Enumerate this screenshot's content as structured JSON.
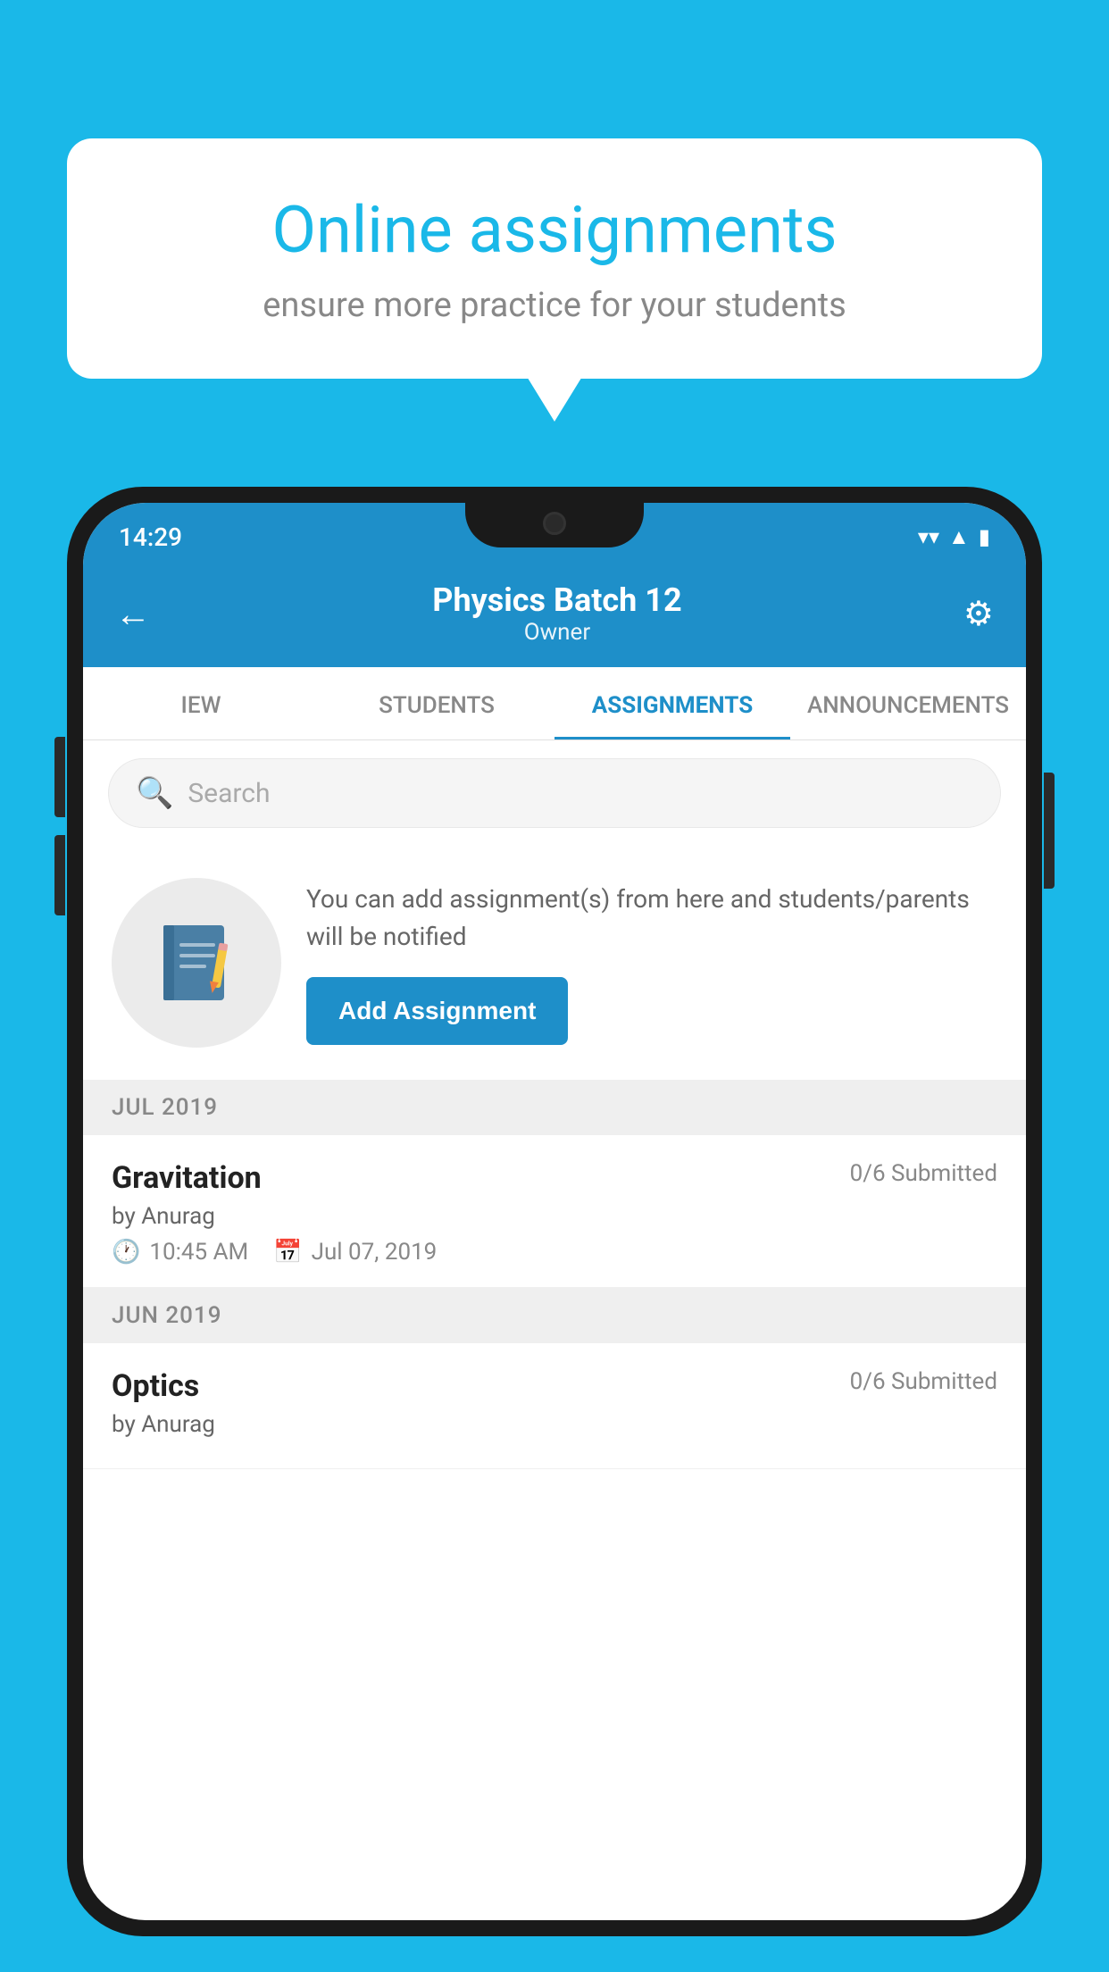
{
  "background_color": "#1ab8e8",
  "speech_bubble": {
    "title": "Online assignments",
    "subtitle": "ensure more practice for your students"
  },
  "status_bar": {
    "time": "14:29",
    "icons": [
      "wifi",
      "signal",
      "battery"
    ]
  },
  "header": {
    "title": "Physics Batch 12",
    "subtitle": "Owner",
    "back_label": "←",
    "settings_label": "⚙"
  },
  "tabs": [
    {
      "label": "IEW",
      "active": false
    },
    {
      "label": "STUDENTS",
      "active": false
    },
    {
      "label": "ASSIGNMENTS",
      "active": true
    },
    {
      "label": "ANNOUNCEMENTS",
      "active": false
    }
  ],
  "search": {
    "placeholder": "Search"
  },
  "add_assignment_section": {
    "info_text": "You can add assignment(s) from here and students/parents will be notified",
    "button_label": "Add Assignment"
  },
  "sections": [
    {
      "month_label": "JUL 2019",
      "assignments": [
        {
          "name": "Gravitation",
          "submitted": "0/6 Submitted",
          "by": "by Anurag",
          "time": "10:45 AM",
          "date": "Jul 07, 2019"
        }
      ]
    },
    {
      "month_label": "JUN 2019",
      "assignments": [
        {
          "name": "Optics",
          "submitted": "0/6 Submitted",
          "by": "by Anurag",
          "time": "",
          "date": ""
        }
      ]
    }
  ]
}
